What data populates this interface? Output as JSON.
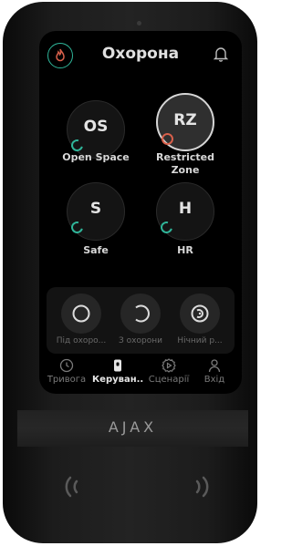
{
  "header": {
    "title": "Охорона",
    "panic_icon": "flame-icon",
    "bell_icon": "bell-icon"
  },
  "groups": [
    {
      "abbr": "OS",
      "label": "Open Space",
      "status": "disarmed",
      "status_color": "#2fb69a"
    },
    {
      "abbr": "RZ",
      "label": "Restricted Zone",
      "status": "armed",
      "status_color": "#d9604b",
      "selected": true
    },
    {
      "abbr": "S",
      "label": "Safe",
      "status": "disarmed",
      "status_color": "#2fb69a"
    },
    {
      "abbr": "H",
      "label": "HR",
      "status": "disarmed",
      "status_color": "#2fb69a"
    }
  ],
  "actions": [
    {
      "label": "Під охоро...",
      "icon": "ring-icon"
    },
    {
      "label": "З охорони",
      "icon": "broken-ring-icon"
    },
    {
      "label": "Нічний р...",
      "icon": "night-mode-icon"
    }
  ],
  "tabs": [
    {
      "label": "Тривога",
      "icon": "clock-alarm-icon",
      "active": false
    },
    {
      "label": "Керуван...",
      "icon": "keypad-icon",
      "active": true
    },
    {
      "label": "Сценарії",
      "icon": "scenario-icon",
      "active": false
    },
    {
      "label": "Вхід",
      "icon": "user-icon",
      "active": false
    }
  ],
  "brand": "AJAX",
  "colors": {
    "accent": "#2fb69a",
    "alert": "#d9604b",
    "screen": "#000000"
  }
}
